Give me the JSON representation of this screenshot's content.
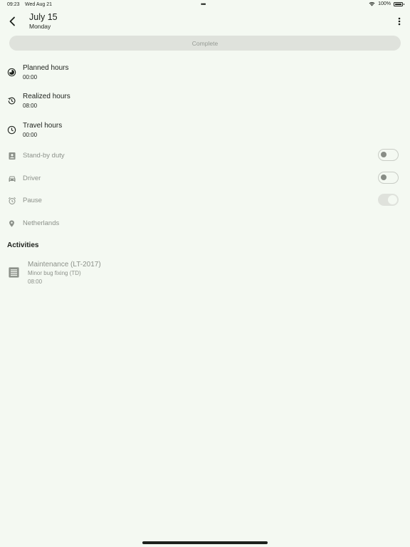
{
  "status_bar": {
    "time": "09:23",
    "date": "Wed Aug 21",
    "dots": "•••",
    "battery_text": "100%"
  },
  "header": {
    "title": "July 15",
    "subtitle": "Monday"
  },
  "complete_button": {
    "label": "Complete"
  },
  "hours": [
    {
      "label": "Planned hours",
      "value": "00:00",
      "icon": "pie-clock-icon"
    },
    {
      "label": "Realized hours",
      "value": "08:00",
      "icon": "history-icon"
    },
    {
      "label": "Travel hours",
      "value": "00:00",
      "icon": "clock-icon"
    }
  ],
  "toggles": [
    {
      "label": "Stand-by duty",
      "icon": "badge-icon",
      "on": false
    },
    {
      "label": "Driver",
      "icon": "car-icon",
      "on": false
    },
    {
      "label": "Pause",
      "icon": "alarm-icon",
      "on": true
    }
  ],
  "location": {
    "label": "Netherlands",
    "icon": "location-pin-icon"
  },
  "activities": {
    "title": "Activities",
    "items": [
      {
        "title": "Maintenance (LT-2017)",
        "description": "Minor bug fixing (TD)",
        "hours": "08:00",
        "icon": "document-list-icon"
      }
    ]
  },
  "colors": {
    "background": "#f4f9f2",
    "text": "#1d211c",
    "muted_text": "#8c918a",
    "disabled_button": "#dfe2dc"
  }
}
